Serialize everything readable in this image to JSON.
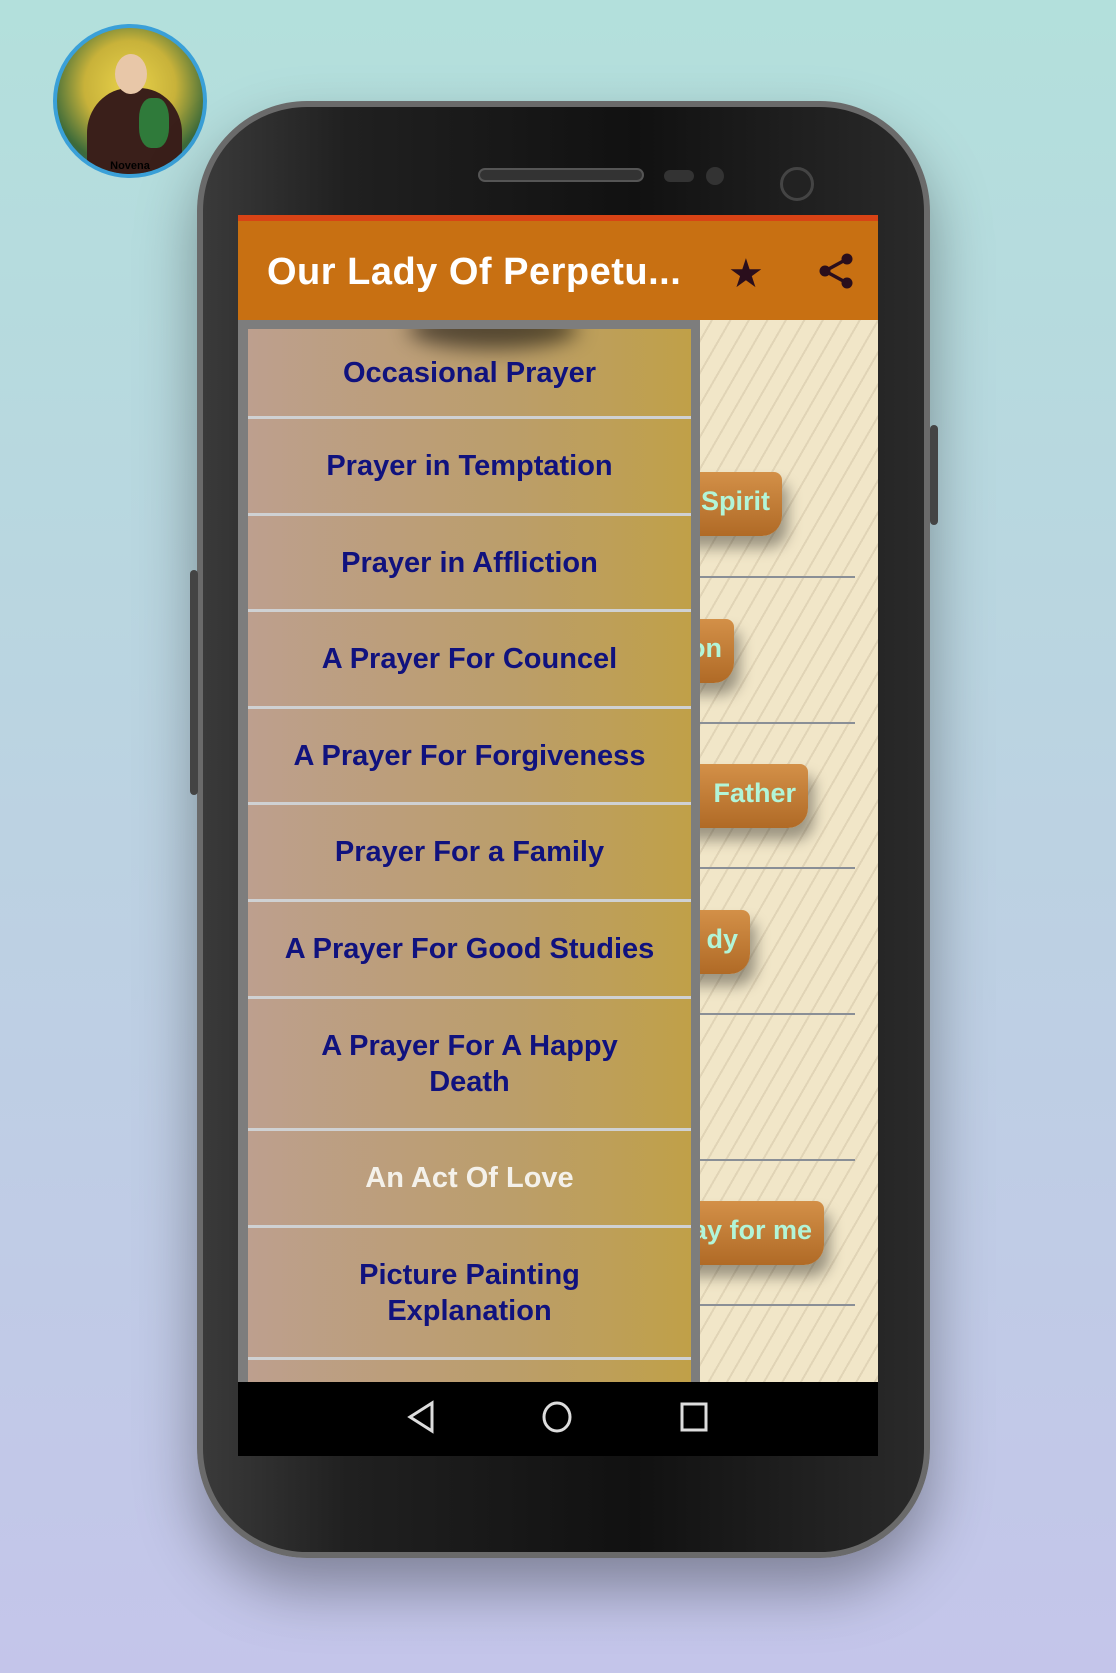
{
  "logo": {
    "text": "Novena"
  },
  "appbar": {
    "title": "Our Lady Of Perpetu...",
    "favorite_icon": "star-icon",
    "share_icon": "share-icon",
    "color": "#c87012"
  },
  "drawer": {
    "items": [
      {
        "label": "Occasional Prayer"
      },
      {
        "label": "Prayer in Temptation"
      },
      {
        "label": "Prayer in Affliction"
      },
      {
        "label": "A Prayer For Councel"
      },
      {
        "label": "A Prayer For Forgiveness"
      },
      {
        "label": "Prayer For a Family"
      },
      {
        "label": "A Prayer For Good Studies"
      },
      {
        "label": "A Prayer For A Happy Death"
      },
      {
        "label": "An Act Of Love",
        "selected": true
      },
      {
        "label": "Picture Painting Explanation"
      }
    ]
  },
  "background_items": [
    "Spirit",
    "on",
    "Father",
    "dy",
    "ay for me"
  ],
  "navbar": {
    "back": "back-icon",
    "home": "home-icon",
    "recents": "recents-icon"
  }
}
